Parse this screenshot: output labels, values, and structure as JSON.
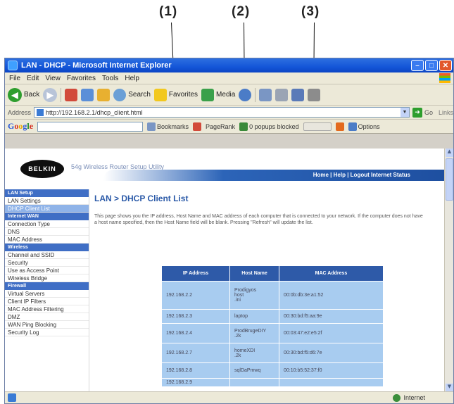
{
  "callouts": [
    "(1)",
    "(2)",
    "(3)"
  ],
  "window": {
    "title": "LAN - DHCP - Microsoft Internet Explorer"
  },
  "menu": [
    "File",
    "Edit",
    "View",
    "Favorites",
    "Tools",
    "Help"
  ],
  "toolbar": {
    "back": "Back",
    "search": "Search",
    "favorites": "Favorites",
    "media": "Media"
  },
  "address": {
    "label": "Address",
    "url": "http://192.168.2.1/dhcp_client.html",
    "go": "Go",
    "links": "Links"
  },
  "google": {
    "bookmarks": "Bookmarks",
    "pagerank": "PageRank",
    "blocked": "0 popups blocked",
    "options": "Options"
  },
  "belkin": {
    "logo": "BELKIN",
    "product": "54g Wireless Router Setup Utility",
    "links": "Home | Help | Logout   Internet Status"
  },
  "sidebar": [
    {
      "type": "section",
      "label": "LAN Setup"
    },
    {
      "type": "item",
      "label": "LAN Settings"
    },
    {
      "type": "active",
      "label": "DHCP Client List"
    },
    {
      "type": "section",
      "label": "Internet WAN"
    },
    {
      "type": "item",
      "label": "Connection Type"
    },
    {
      "type": "item",
      "label": "DNS"
    },
    {
      "type": "item",
      "label": "MAC Address"
    },
    {
      "type": "section",
      "label": "Wireless"
    },
    {
      "type": "item",
      "label": "Channel and SSID"
    },
    {
      "type": "item",
      "label": "Security"
    },
    {
      "type": "item",
      "label": "Use as Access Point"
    },
    {
      "type": "item",
      "label": "Wireless Bridge"
    },
    {
      "type": "section",
      "label": "Firewall"
    },
    {
      "type": "item",
      "label": "Virtual Servers"
    },
    {
      "type": "item",
      "label": "Client IP Filters"
    },
    {
      "type": "item",
      "label": "MAC Address Filtering"
    },
    {
      "type": "item",
      "label": "DMZ"
    },
    {
      "type": "item",
      "label": "WAN Ping Blocking"
    },
    {
      "type": "item",
      "label": "Security Log"
    }
  ],
  "main": {
    "title": "LAN > DHCP Client List",
    "description": "This page shows you the IP address, Host Name and MAC address of each computer that is connected to your network. If the computer does not have a host name specified, then the Host Name field will be blank. Pressing \"Refresh\" will update the list."
  },
  "table": {
    "headers": [
      "IP Address",
      "Host Name",
      "MAC Address"
    ],
    "rows": [
      [
        "192.168.2.2",
        "Prodigyos\nhost\n.ini",
        "00:0b:db:3e:a1:52"
      ],
      [
        "192.168.2.3",
        "laptop",
        "00:30:bd:f5:aa:9e"
      ],
      [
        "192.168.2.4",
        "ProdBrugeDIY\n.2k",
        "00:03:47:e2:e5:2f"
      ],
      [
        "192.168.2.7",
        "homeXDI\n.2k",
        "00:30:bd:f5:d6:7e"
      ],
      [
        "192.168.2.8",
        "sqlDaPmwq",
        "00:10:b5:52:37:f0"
      ],
      [
        "192.168.2.9",
        "",
        ""
      ]
    ]
  },
  "status": {
    "zone": "Internet"
  }
}
